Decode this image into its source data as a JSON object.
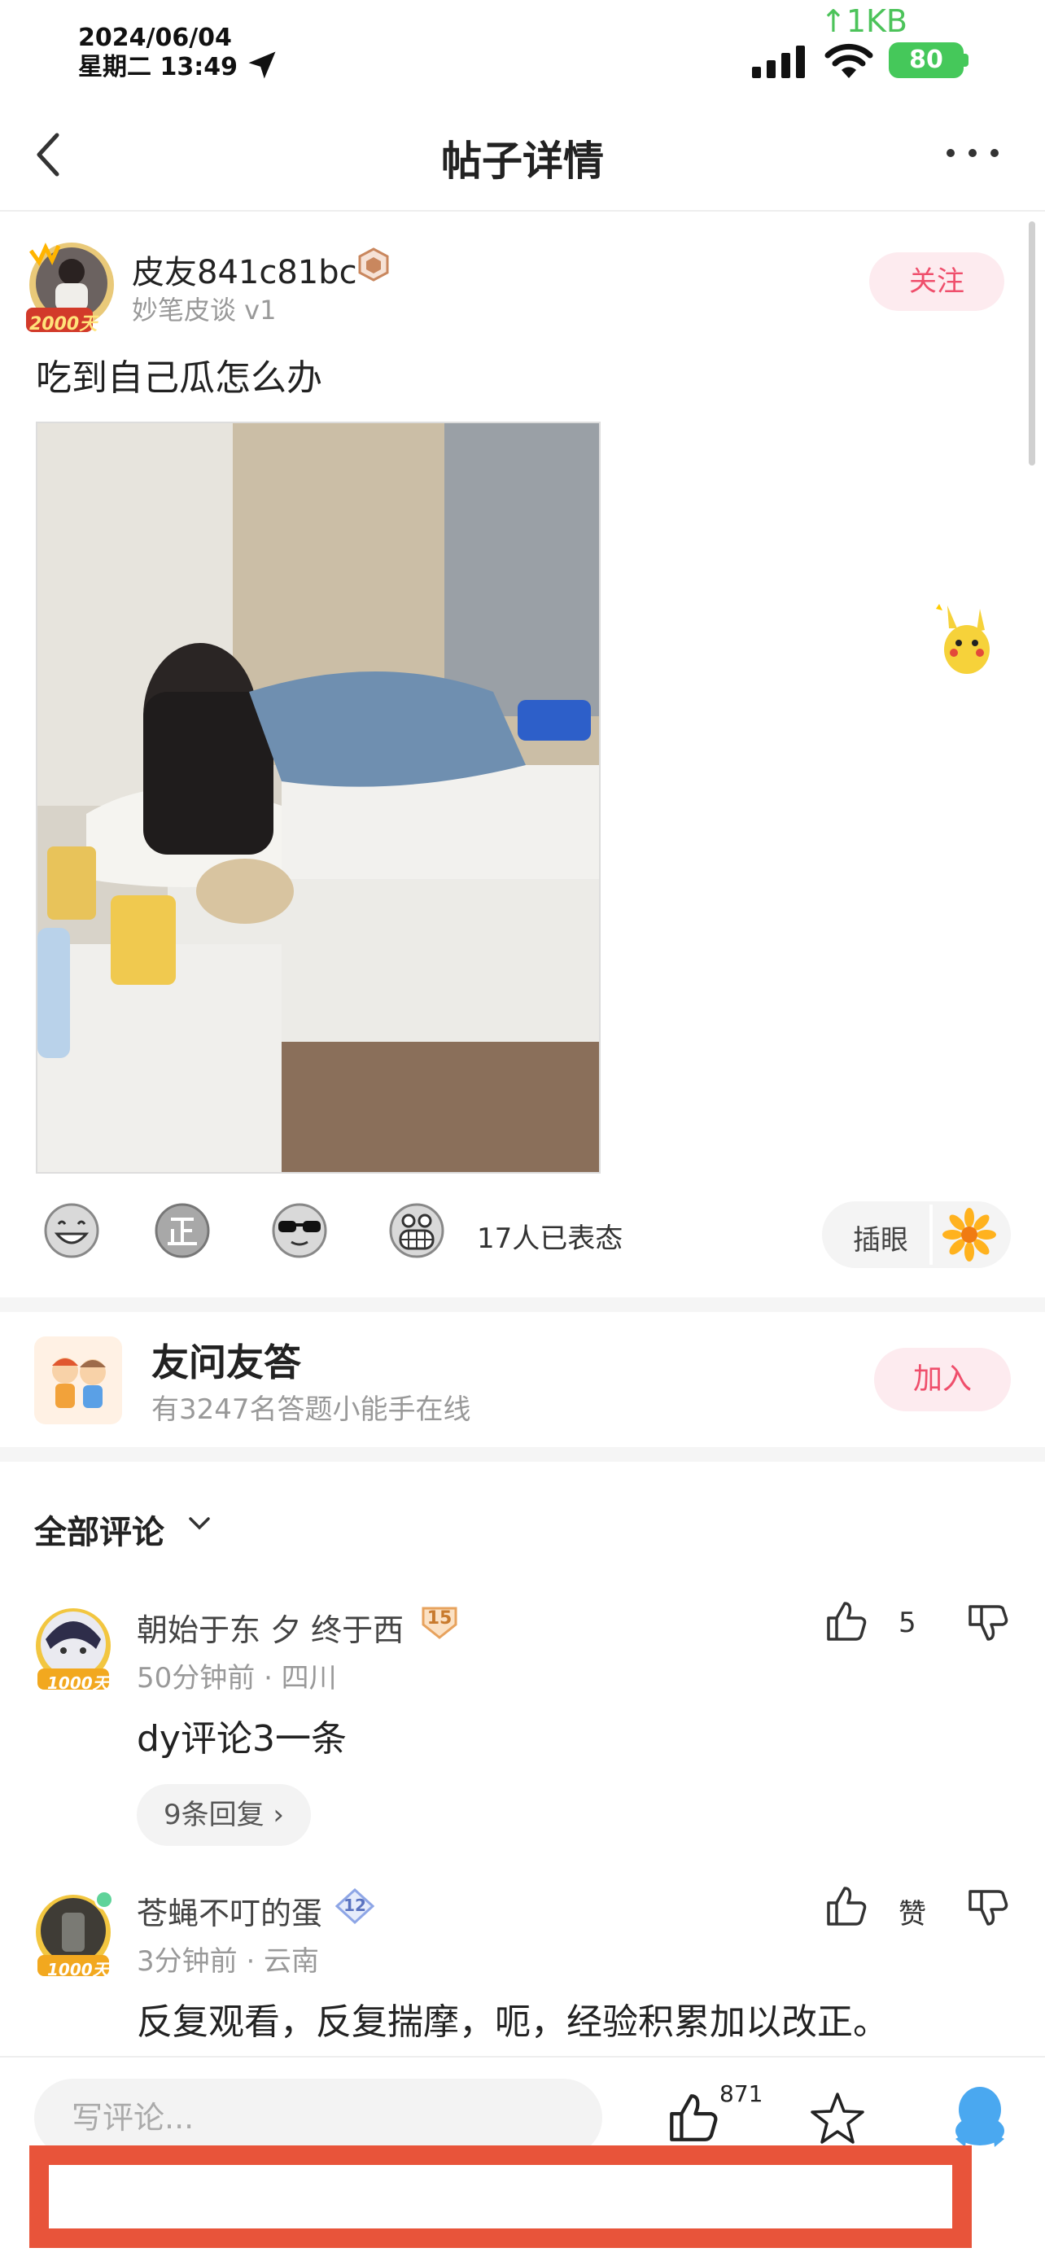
{
  "status_bar": {
    "date": "2024/06/04",
    "weekday_time": "星期二 13:49",
    "net_speed": "↑1KB",
    "battery": "80"
  },
  "nav": {
    "title": "帖子详情"
  },
  "post": {
    "author": {
      "name": "皮友841c81bc",
      "subtitle": "妙笔皮谈 v1",
      "avatar_badge": "2000天"
    },
    "follow_label": "关注",
    "text": "吃到自己瓜怎么办",
    "reactions_count": "17人已表态",
    "poke_label": "插眼",
    "colors": {
      "accent": "#ef4f6c",
      "accent_bg": "#fdebef"
    }
  },
  "qa": {
    "title": "友问友答",
    "subtitle": "有3247名答题小能手在线",
    "join_label": "加入"
  },
  "comments_header": "全部评论",
  "comments": [
    {
      "name": "朝始于东 夕 终于西",
      "level": "15",
      "meta": "50分钟前 · 四川",
      "text": "dy评论3一条",
      "likes": "5",
      "avatar_badge": "1000天",
      "replies": "9条回复"
    },
    {
      "name": "苍蝇不叮的蛋",
      "level": "12",
      "meta": "3分钟前 · 云南",
      "text": "反复观看，反复揣摩，呃，经验积累加以改正。",
      "likes": "赞",
      "avatar_badge": "1000天"
    }
  ],
  "bottom_bar": {
    "comment_placeholder": "写评论...",
    "like_count": "871"
  }
}
